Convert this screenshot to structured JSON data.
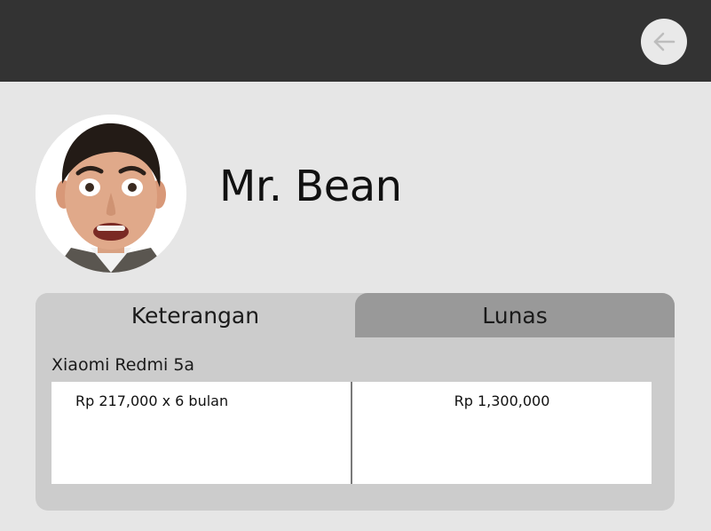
{
  "header": {
    "back_icon": "arrow-left-icon",
    "colors": {
      "bar": "#333333",
      "button": "#e9e9e9",
      "icon": "#bdbdbd"
    }
  },
  "profile": {
    "name": "Mr. Bean",
    "avatar": "profile-photo"
  },
  "tabs": [
    {
      "label": "Keterangan",
      "active": true
    },
    {
      "label": "Lunas",
      "active": false
    }
  ],
  "item": {
    "title": "Xiaomi Redmi 5a",
    "installment": "Rp 217,000 x 6 bulan",
    "total": "Rp 1,300,000"
  },
  "colors": {
    "page_bg": "#e6e6e6",
    "card_bg": "#cccccc",
    "inactive_tab": "#999999",
    "table_bg": "#ffffff"
  }
}
